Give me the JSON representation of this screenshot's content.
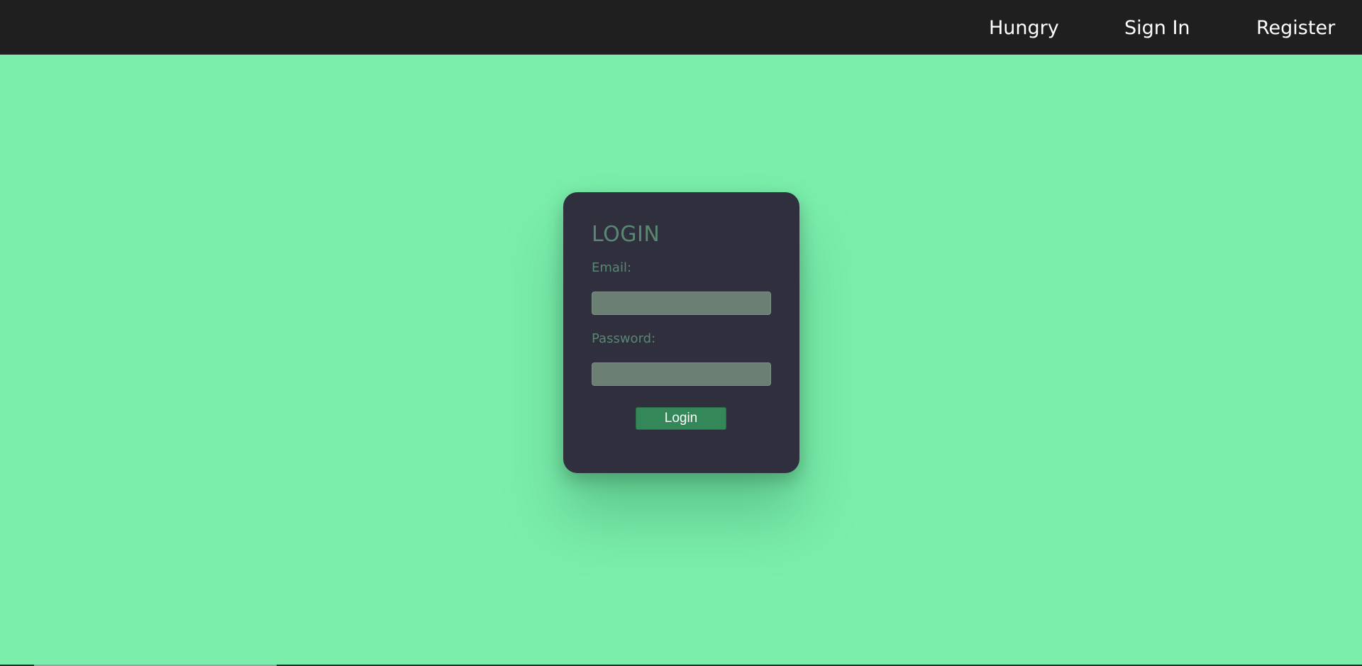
{
  "navbar": {
    "links": [
      {
        "label": "Hungry"
      },
      {
        "label": "Sign In"
      },
      {
        "label": "Register"
      }
    ]
  },
  "login_card": {
    "title": "LOGIN",
    "email_label": "Email:",
    "email_value": "",
    "password_label": "Password:",
    "password_value": "",
    "submit_label": "Login"
  },
  "colors": {
    "background": "#7beeac",
    "navbar": "#1f1f1f",
    "card": "#302f3d",
    "label_text": "#5a8772",
    "input_bg": "#6b7f72",
    "button": "#348759"
  }
}
